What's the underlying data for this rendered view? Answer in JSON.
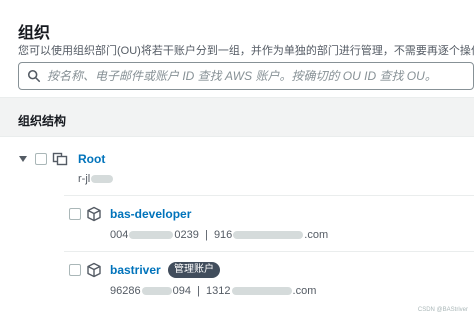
{
  "header": {
    "title": "组织",
    "description": "您可以使用组织部门(OU)将若干账户分到一组，并作为单独的部门进行管理，不需要再逐个操作。"
  },
  "search": {
    "placeholder": "按名称、电子邮件或账户 ID 查找 AWS 账户。按确切的 OU ID 查找 OU。",
    "value": ""
  },
  "structure": {
    "title": "组织结构",
    "root": {
      "name": "Root",
      "id_visible_start": "r-jl"
    },
    "accounts": [
      {
        "name": "bas-developer",
        "id_start": "004",
        "id_end": "0239",
        "email_start": "916",
        "email_end": ".com",
        "badge": ""
      },
      {
        "name": "bastriver",
        "id_start": "96286",
        "id_end": "094",
        "email_start": "1312",
        "email_end": ".com",
        "badge": "管理账户"
      }
    ]
  },
  "watermark": "CSDN @BAStriver",
  "colors": {
    "link": "#0073bb",
    "badge_bg": "#414d5c",
    "border": "#879196"
  }
}
